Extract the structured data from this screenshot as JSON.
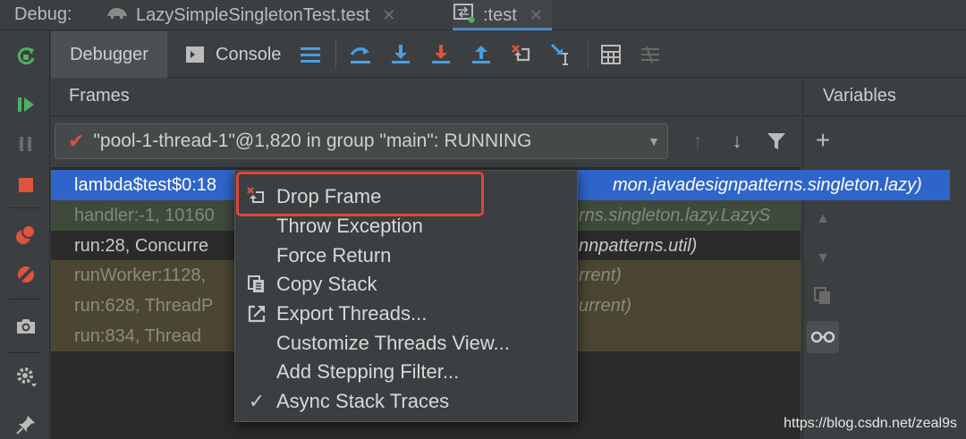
{
  "debug_bar": {
    "label": "Debug:",
    "tabs": [
      {
        "label": "LazySimpleSingletonTest.test",
        "icon": "test-runner-icon"
      },
      {
        "label": ":test",
        "icon": "gradle-run-icon"
      }
    ]
  },
  "tool_tabs": {
    "debugger": "Debugger",
    "console": "Console"
  },
  "frames": {
    "title": "Frames",
    "thread": "\"pool-1-thread-1\"@1,820 in group \"main\": RUNNING",
    "rows": [
      {
        "head": "lambda$test$0:18",
        "tail": "mon.javadesignpatterns.singleton.lazy)"
      },
      {
        "head": "handler:-1, 10160",
        "tail": "rns.singleton.lazy.LazyS"
      },
      {
        "head": "run:28, Concurre",
        "tail": "nnpatterns.util)"
      },
      {
        "head": "runWorker:1128,",
        "tail": "rrent)"
      },
      {
        "head": "run:628, ThreadP",
        "tail": "urrent)"
      },
      {
        "head": "run:834, Thread",
        "tail": ""
      }
    ]
  },
  "variables": {
    "title": "Variables"
  },
  "context_menu": {
    "items": [
      {
        "label": "Drop Frame",
        "icon": "drop-frame-icon"
      },
      {
        "label": "Throw Exception",
        "icon": ""
      },
      {
        "label": "Force Return",
        "icon": ""
      },
      {
        "label": "Copy Stack",
        "icon": "copy-icon"
      },
      {
        "label": "Export Threads...",
        "icon": "export-icon"
      },
      {
        "label": "Customize Threads View...",
        "icon": ""
      },
      {
        "label": "Add Stepping Filter...",
        "icon": ""
      },
      {
        "label": "Async Stack Traces",
        "icon": "checkmark-icon"
      }
    ]
  },
  "watermark": "https://blog.csdn.net/zeal9s",
  "colors": {
    "selected_row": "#2f65ca",
    "highlight_border": "#d9473b",
    "resume_green": "#4fb062",
    "stop_red": "#e0533d",
    "step_blue": "#4a9ee0"
  }
}
